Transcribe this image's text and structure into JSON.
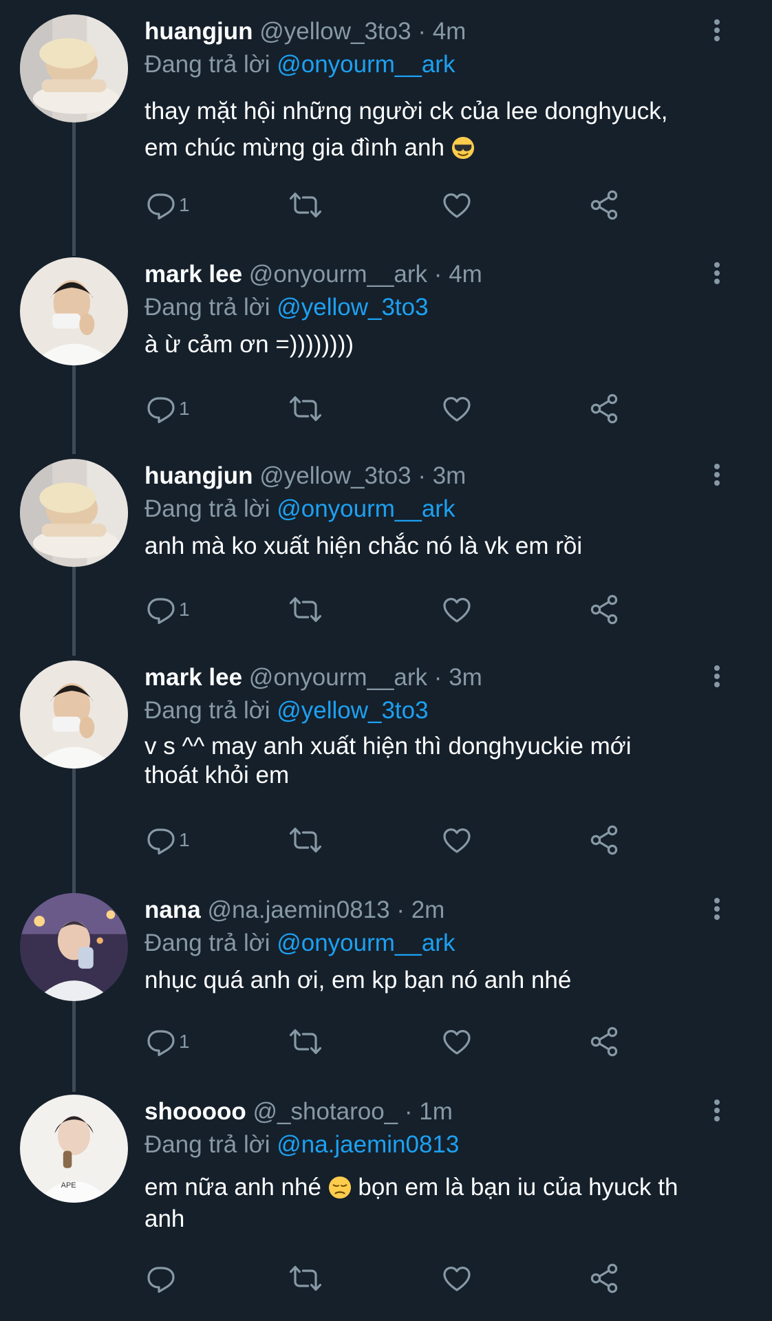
{
  "reply_prefix": "Đang trả lời",
  "tweets": [
    {
      "name": "huangjun",
      "handle": "@yellow_3to3",
      "time": "4m",
      "reply_to": "@onyourm__ark",
      "text_line1": "thay mặt hội những người ck của lee donghyuck,",
      "text_line2": "em chúc mừng gia đình anh",
      "emoji": "smiling-face-with-sunglasses",
      "reply_count": "1"
    },
    {
      "name": "mark lee",
      "handle": "@onyourm__ark",
      "time": "4m",
      "reply_to": "@yellow_3to3",
      "text_line1": "à ừ cảm ơn =))))))))",
      "reply_count": "1"
    },
    {
      "name": "huangjun",
      "handle": "@yellow_3to3",
      "time": "3m",
      "reply_to": "@onyourm__ark",
      "text_line1": "anh mà ko xuất hiện chắc nó là vk em rồi",
      "reply_count": "1"
    },
    {
      "name": "mark lee",
      "handle": "@onyourm__ark",
      "time": "3m",
      "reply_to": "@yellow_3to3",
      "text_line1": "v s ^^ may anh xuất hiện thì donghyuckie mới",
      "text_line2": "thoát khỏi em",
      "reply_count": "1"
    },
    {
      "name": "nana",
      "handle": "@na.jaemin0813",
      "time": "2m",
      "reply_to": "@onyourm__ark",
      "text_line1": "nhục quá anh ơi, em kp bạn nó anh nhé",
      "reply_count": "1"
    },
    {
      "name": "shooooo",
      "handle": "@_shotaroo_",
      "time": "1m",
      "reply_to": "@na.jaemin0813",
      "text_line1_a": "em nữa anh nhé",
      "emoji": "pensive-face",
      "text_line1_b": "bọn em là bạn iu của hyuck th",
      "text_line2": "anh",
      "reply_count": ""
    }
  ],
  "separator": "·",
  "colors": {
    "background": "#15202b",
    "text": "#ffffff",
    "muted": "#8899a6",
    "link": "#1da1f2",
    "thread_line": "#3d4b59"
  },
  "icons": [
    "reply-icon",
    "retweet-icon",
    "like-icon",
    "share-icon",
    "more-icon"
  ]
}
